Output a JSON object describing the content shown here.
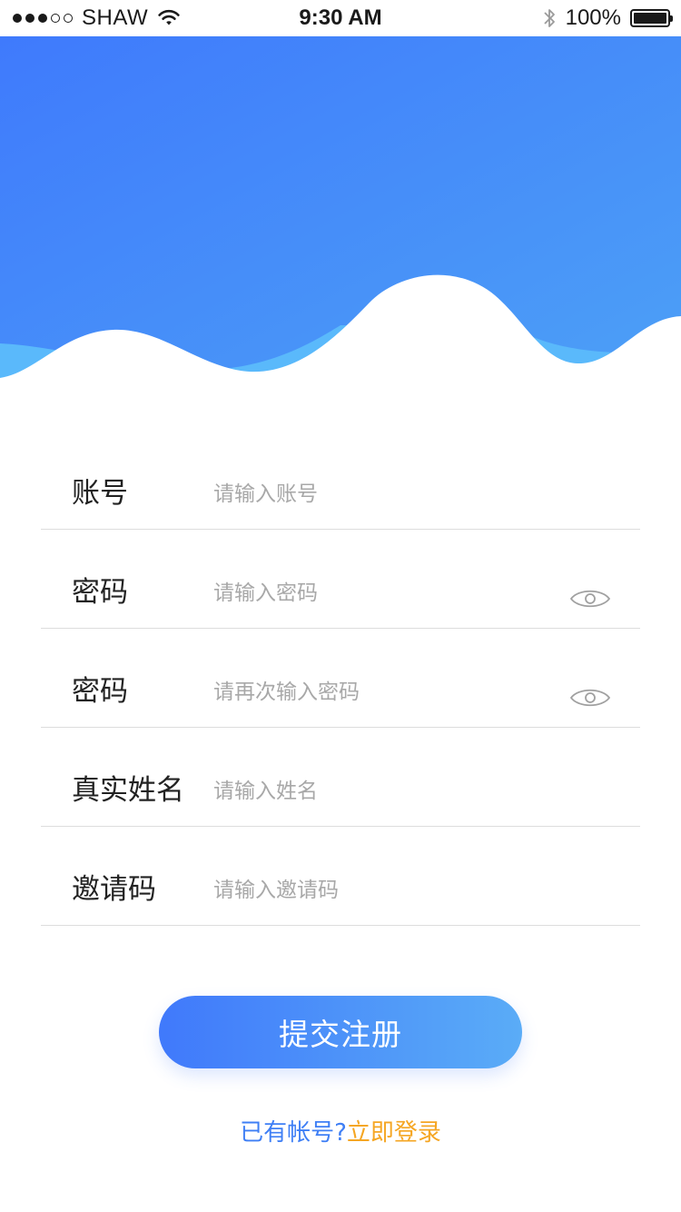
{
  "status_bar": {
    "carrier": "SHAW",
    "time": "9:30 AM",
    "battery": "100%"
  },
  "colors": {
    "accent": "#4079fb",
    "gradient_end": "#5aacf7",
    "link": "#f5a623",
    "text": "#222222",
    "placeholder": "#a8a8a8"
  },
  "form": {
    "account": {
      "label": "账号",
      "placeholder": "请输入账号"
    },
    "password": {
      "label": "密码",
      "placeholder": "请输入密码",
      "icon": "eye-icon"
    },
    "password_confirm": {
      "label": "密码",
      "placeholder": "请再次输入密码",
      "icon": "eye-icon"
    },
    "real_name": {
      "label": "真实姓名",
      "placeholder": "请输入姓名"
    },
    "invite_code": {
      "label": "邀请码",
      "placeholder": "请输入邀请码"
    }
  },
  "submit_label": "提交注册",
  "login_prompt": "已有帐号?",
  "login_link": "立即登录"
}
